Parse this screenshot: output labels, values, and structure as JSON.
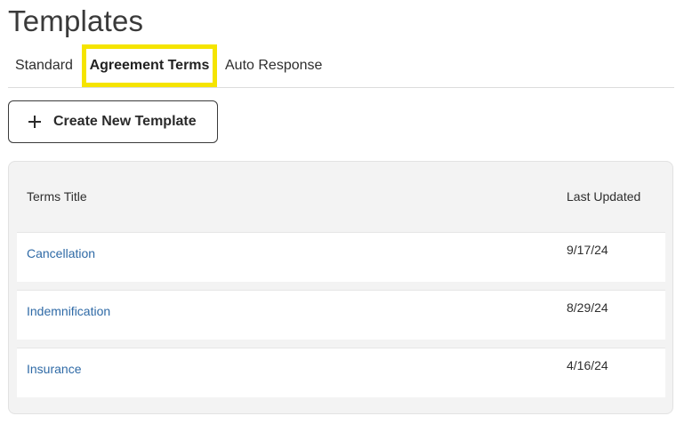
{
  "page": {
    "title": "Templates"
  },
  "tabs": [
    {
      "label": "Standard",
      "active": false
    },
    {
      "label": "Agreement Terms",
      "active": true
    },
    {
      "label": "Auto Response",
      "active": false
    }
  ],
  "toolbar": {
    "create_label": "Create New Template",
    "create_icon": "plus-icon"
  },
  "table": {
    "columns": [
      "Terms Title",
      "Last Updated"
    ],
    "rows": [
      {
        "title": "Cancellation",
        "updated": "9/17/24"
      },
      {
        "title": "Indemnification",
        "updated": "8/29/24"
      },
      {
        "title": "Insurance",
        "updated": "4/16/24"
      }
    ]
  },
  "colors": {
    "highlight": "#f5e400",
    "link": "#2f6aa6",
    "panel_bg": "#f3f3f3"
  }
}
